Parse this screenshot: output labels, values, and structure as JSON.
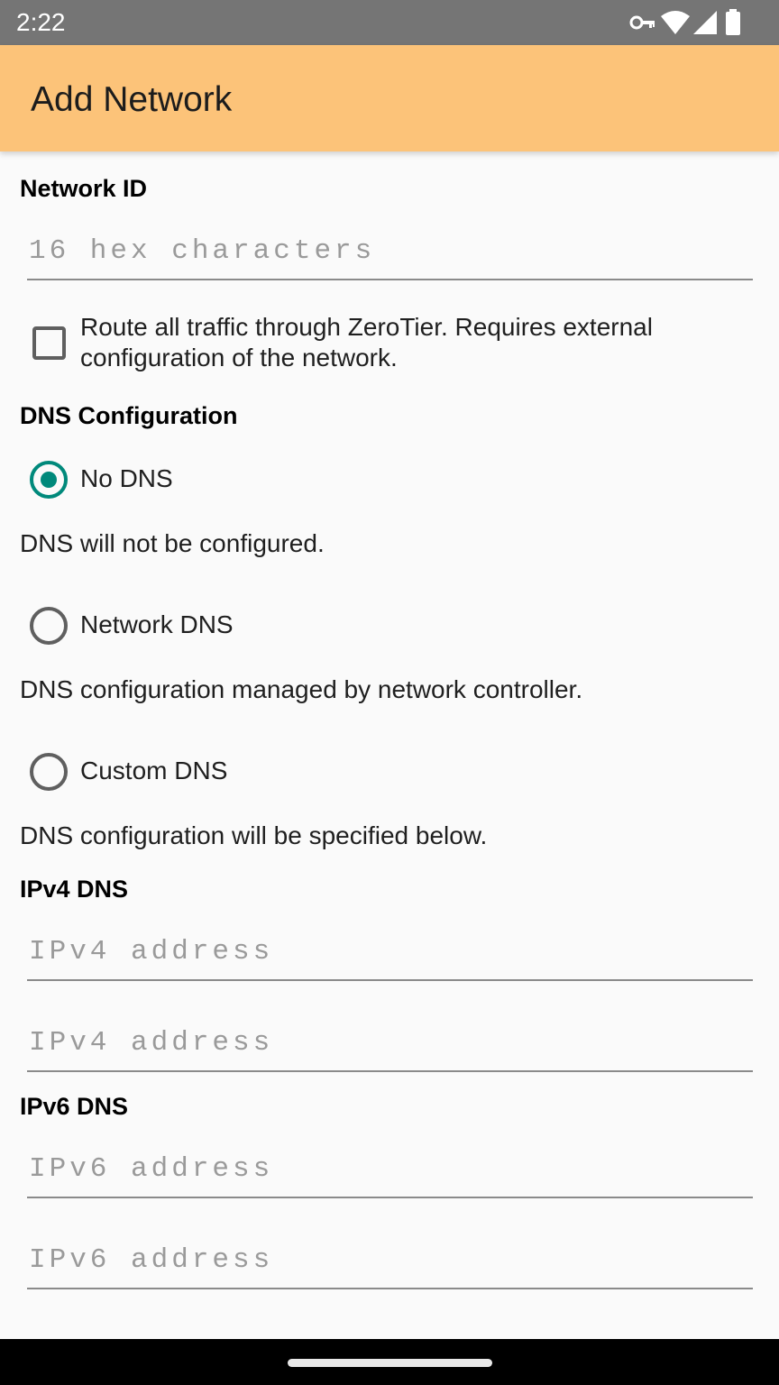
{
  "status_bar": {
    "time": "2:22",
    "icons": [
      "vpn-key-icon",
      "wifi-icon",
      "cell-signal-icon",
      "battery-icon"
    ],
    "background": "#757575"
  },
  "app_bar": {
    "title": "Add Network",
    "background": "#fcc379"
  },
  "network_id": {
    "label": "Network ID",
    "placeholder": "16 hex characters",
    "value": ""
  },
  "route_all": {
    "label": "Route all traffic through ZeroTier. Requires external configuration of the network.",
    "checked": false
  },
  "dns": {
    "label": "DNS Configuration",
    "accent": "#00897b",
    "options": [
      {
        "label": "No DNS",
        "description": "DNS will not be configured.",
        "selected": true
      },
      {
        "label": "Network DNS",
        "description": "DNS configuration managed by network controller.",
        "selected": false
      },
      {
        "label": "Custom DNS",
        "description": "DNS configuration will be specified below.",
        "selected": false
      }
    ]
  },
  "ipv4_dns": {
    "label": "IPv4 DNS",
    "fields": [
      {
        "placeholder": "IPv4 address",
        "value": ""
      },
      {
        "placeholder": "IPv4 address",
        "value": ""
      }
    ]
  },
  "ipv6_dns": {
    "label": "IPv6 DNS",
    "fields": [
      {
        "placeholder": "IPv6 address",
        "value": ""
      },
      {
        "placeholder": "IPv6 address",
        "value": ""
      }
    ]
  }
}
